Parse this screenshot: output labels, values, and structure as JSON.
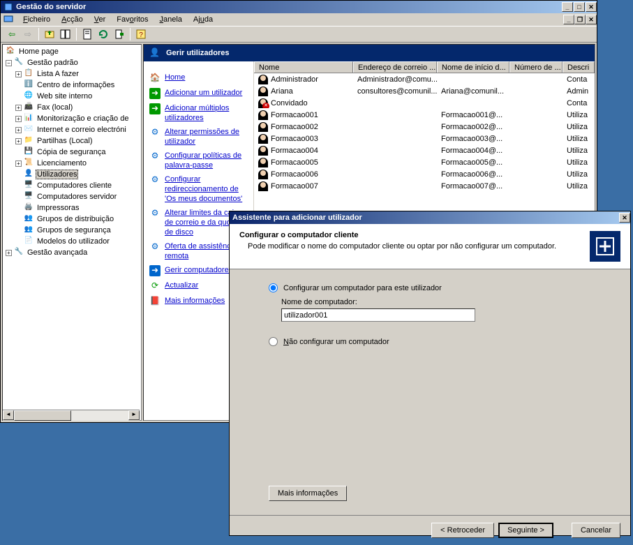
{
  "main_window": {
    "title": "Gestão do servidor"
  },
  "menu": {
    "ficheiro": "Ficheiro",
    "accao": "Acção",
    "ver": "Ver",
    "favoritos": "Favoritos",
    "janela": "Janela",
    "ajuda": "Ajuda"
  },
  "tree": {
    "home": "Home page",
    "gestao_padrao": "Gestão padrão",
    "lista_a_fazer": "Lista A fazer",
    "centro_info": "Centro de informações",
    "web_site": "Web site interno",
    "fax": "Fax (local)",
    "monitorizacao": "Monitorização e criação de",
    "internet_correio": "Internet e correio electróni",
    "partilhas": "Partilhas (Local)",
    "copia_seguranca": "Cópia de segurança",
    "licenciamento": "Licenciamento",
    "utilizadores": "Utilizadores",
    "computadores_cliente": "Computadores cliente",
    "computadores_servidor": "Computadores servidor",
    "impressoras": "Impressoras",
    "grupos_distribuicao": "Grupos de distribuição",
    "grupos_seguranca": "Grupos de segurança",
    "modelos_utilizador": "Modelos do utilizador",
    "gestao_avancada": "Gestão avançada"
  },
  "panel": {
    "title": "Gerir utilizadores"
  },
  "tasks": {
    "home": "Home",
    "add_user": "Adicionar um utilizador",
    "add_multi": "Adicionar múltiplos utilizadores",
    "change_perms": "Alterar permissões de utilizador",
    "config_pass": "Configurar políticas de palavra-passe",
    "config_redir": "Configurar redireccionamento de 'Os meus documentos'",
    "change_limits": "Alterar limites da caixa de correio e da quota de disco",
    "offer_assist": "Oferta de assistência remota",
    "manage_comp": "Gerir computadores",
    "refresh": "Actualizar",
    "more_info": "Mais informações"
  },
  "columns": {
    "nome": "Nome",
    "email": "Endereço de correio ...",
    "login": "Nome de início d...",
    "numero": "Número de ...",
    "descri": "Descri"
  },
  "users": [
    {
      "nome": "Administrador",
      "email": "Administrador@comu...",
      "login": "",
      "descri": "Conta"
    },
    {
      "nome": "Ariana",
      "email": "consultores@comunil...",
      "login": "Ariana@comunil...",
      "descri": "Admin"
    },
    {
      "nome": "Convidado",
      "email": "",
      "login": "",
      "descri": "Conta",
      "blocked": true
    },
    {
      "nome": "Formacao001",
      "email": "",
      "login": "Formacao001@...",
      "descri": "Utiliza"
    },
    {
      "nome": "Formacao002",
      "email": "",
      "login": "Formacao002@...",
      "descri": "Utiliza"
    },
    {
      "nome": "Formacao003",
      "email": "",
      "login": "Formacao003@...",
      "descri": "Utiliza"
    },
    {
      "nome": "Formacao004",
      "email": "",
      "login": "Formacao004@...",
      "descri": "Utiliza"
    },
    {
      "nome": "Formacao005",
      "email": "",
      "login": "Formacao005@...",
      "descri": "Utiliza"
    },
    {
      "nome": "Formacao006",
      "email": "",
      "login": "Formacao006@...",
      "descri": "Utiliza"
    },
    {
      "nome": "Formacao007",
      "email": "",
      "login": "Formacao007@...",
      "descri": "Utiliza"
    }
  ],
  "dialog": {
    "window_title": "Assistente para adicionar utilizador",
    "title": "Configurar o computador cliente",
    "subtitle": "Pode modificar o nome do computador cliente ou optar por não configurar um computador.",
    "option_configure": "Configurar um computador para este utilizador",
    "field_label": "Nome de computador:",
    "field_value": "utilizador001",
    "option_no_configure": "Não configurar um computador",
    "more_info": "Mais informações",
    "back": "< Retroceder",
    "next": "Seguinte >",
    "cancel": "Cancelar"
  }
}
